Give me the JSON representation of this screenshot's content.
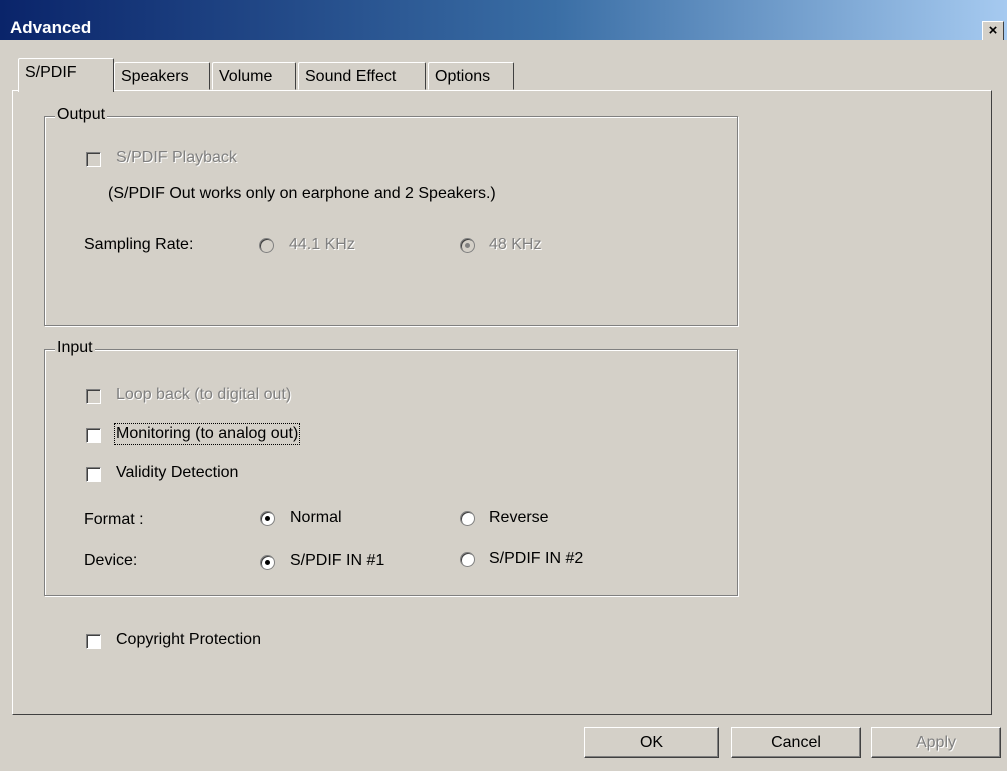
{
  "window": {
    "title": "Advanced",
    "close_glyph": "×"
  },
  "tabs": [
    {
      "label": "S/PDIF",
      "active": true
    },
    {
      "label": "Speakers"
    },
    {
      "label": "Volume"
    },
    {
      "label": "Sound Effect"
    },
    {
      "label": "Options"
    }
  ],
  "output": {
    "label": "Output",
    "playback": {
      "label": "S/PDIF Playback",
      "checked": false,
      "enabled": false
    },
    "note": "(S/PDIF Out works only on earphone and 2 Speakers.)",
    "sampling_rate": {
      "label": "Sampling Rate:",
      "options": [
        {
          "label": "44.1 KHz",
          "selected": false,
          "enabled": false
        },
        {
          "label": "48 KHz",
          "selected": true,
          "enabled": false
        }
      ]
    }
  },
  "input": {
    "label": "Input",
    "loop_back": {
      "label": "Loop back (to digital out)",
      "checked": false,
      "enabled": false
    },
    "monitoring": {
      "label": "Monitoring (to analog out)",
      "checked": false,
      "enabled": true
    },
    "validity": {
      "label": "Validity Detection",
      "checked": false,
      "enabled": true
    },
    "format": {
      "label": "Format :",
      "options": [
        {
          "label": "Normal",
          "selected": true
        },
        {
          "label": "Reverse",
          "selected": false
        }
      ]
    },
    "device": {
      "label": "Device:",
      "options": [
        {
          "label": "S/PDIF IN #1",
          "selected": true
        },
        {
          "label": "S/PDIF IN #2",
          "selected": false
        }
      ]
    }
  },
  "copyright": {
    "label": "Copyright Protection",
    "checked": false
  },
  "buttons": {
    "ok": "OK",
    "cancel": "Cancel",
    "apply": "Apply"
  }
}
